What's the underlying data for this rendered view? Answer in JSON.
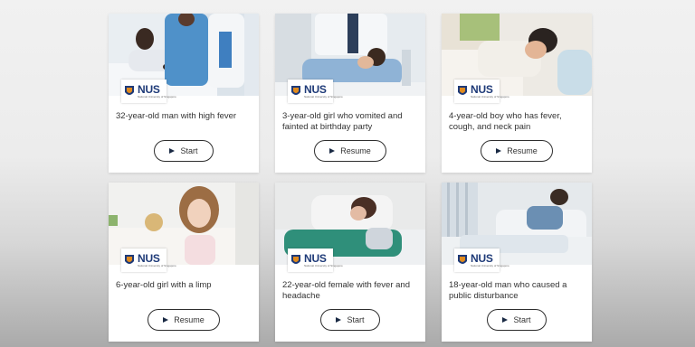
{
  "cases": [
    {
      "title": "32-year-old man with high fever",
      "button": "Start",
      "logo": "NUS",
      "logo_sub": "National University of Singapore"
    },
    {
      "title": "3-year-old girl who vomited and fainted at birthday party",
      "button": "Resume",
      "logo": "NUS",
      "logo_sub": "National University of Singapore"
    },
    {
      "title": "4-year-old boy who has fever, cough, and neck pain",
      "button": "Resume",
      "logo": "NUS",
      "logo_sub": "National University of Singapore"
    },
    {
      "title": "6-year-old girl with a limp",
      "button": "Resume",
      "logo": "NUS",
      "logo_sub": "National University of Singapore"
    },
    {
      "title": "22-year-old female with fever and headache",
      "button": "Start",
      "logo": "NUS",
      "logo_sub": "National University of Singapore"
    },
    {
      "title": "18-year-old man who caused a public disturbance",
      "button": "Start",
      "logo": "NUS",
      "logo_sub": "National University of Singapore"
    }
  ],
  "colors": {
    "brand": "#1e3a78",
    "card_bg": "#ffffff",
    "button_border": "#2e2e2e"
  }
}
